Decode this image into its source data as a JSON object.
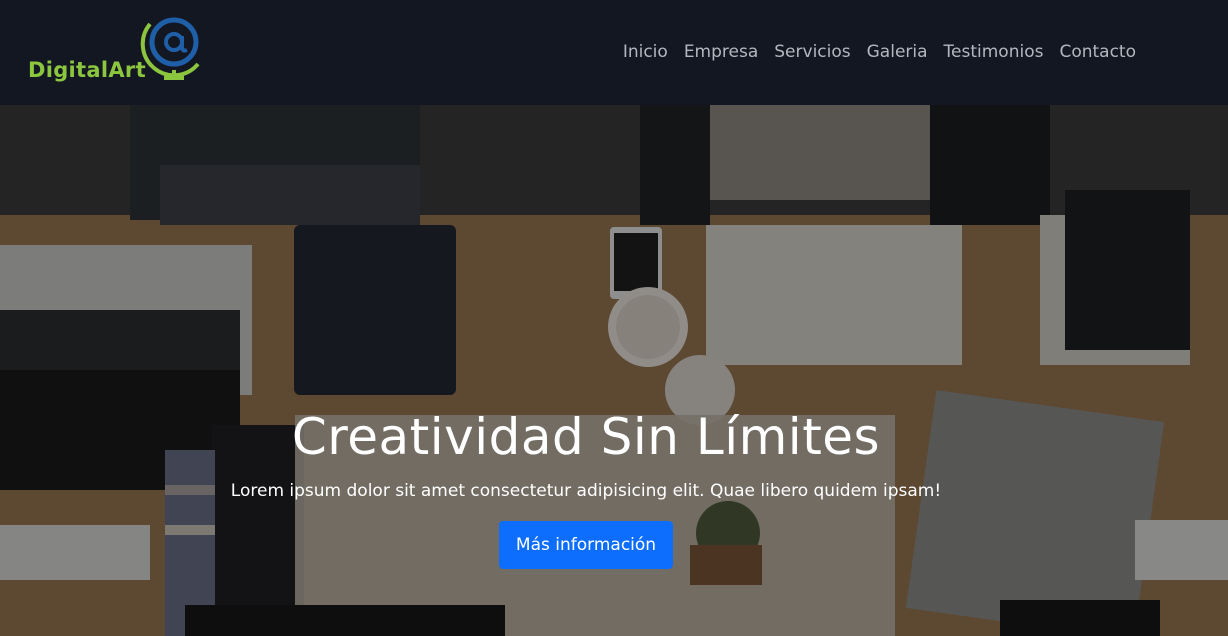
{
  "brand": {
    "name": "DigitalArt",
    "logo_icon": "globe-at-sign-icon",
    "colors": {
      "green": "#8cc63f",
      "blue": "#1f5fa8"
    }
  },
  "nav": {
    "items": [
      {
        "label": "Inicio"
      },
      {
        "label": "Empresa"
      },
      {
        "label": "Servicios"
      },
      {
        "label": "Galeria"
      },
      {
        "label": "Testimonios"
      },
      {
        "label": "Contacto"
      }
    ]
  },
  "hero": {
    "title": "Creatividad Sin Límites",
    "subtitle": "Lorem ipsum dolor sit amet consectetur adipisicing elit. Quae libero quidem ipsam!",
    "button_label": "Más información",
    "button_color": "#0d6efd"
  }
}
